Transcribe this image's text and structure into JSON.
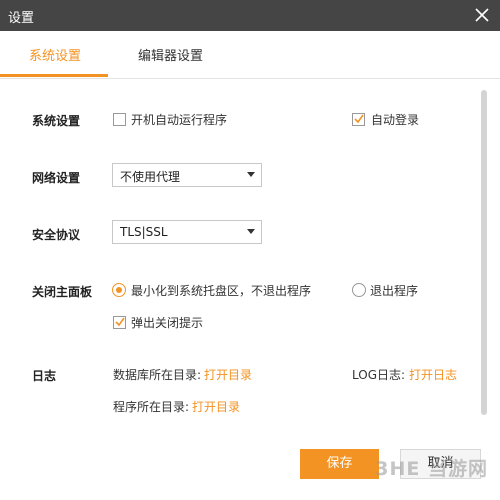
{
  "window": {
    "title": "设置"
  },
  "tabs": [
    {
      "label": "系统设置",
      "active": true
    },
    {
      "label": "编辑器设置",
      "active": false
    }
  ],
  "system": {
    "label": "系统设置",
    "autostart_label": "开机自动运行程序",
    "autostart_checked": false,
    "autologin_label": "自动登录",
    "autologin_checked": true
  },
  "network": {
    "label": "网络设置",
    "selected": "不使用代理"
  },
  "security": {
    "label": "安全协议",
    "selected": "TLS|SSL"
  },
  "close_panel": {
    "label": "关闭主面板",
    "option_minimize": "最小化到系统托盘区，不退出程序",
    "option_exit": "退出程序",
    "popup_label": "弹出关闭提示",
    "popup_checked": true
  },
  "log": {
    "label": "日志",
    "db_dir_label": "数据库所在目录:",
    "db_dir_link": "打开目录",
    "log_label": "LOG日志:",
    "log_link": "打开日志",
    "program_dir_label": "程序所在目录:",
    "program_dir_link": "打开目录"
  },
  "buttons": {
    "save": "保存",
    "cancel": "取消"
  },
  "watermark": "3HE 当游网",
  "colors": {
    "accent": "#f39323",
    "titlebar": "#454545"
  }
}
